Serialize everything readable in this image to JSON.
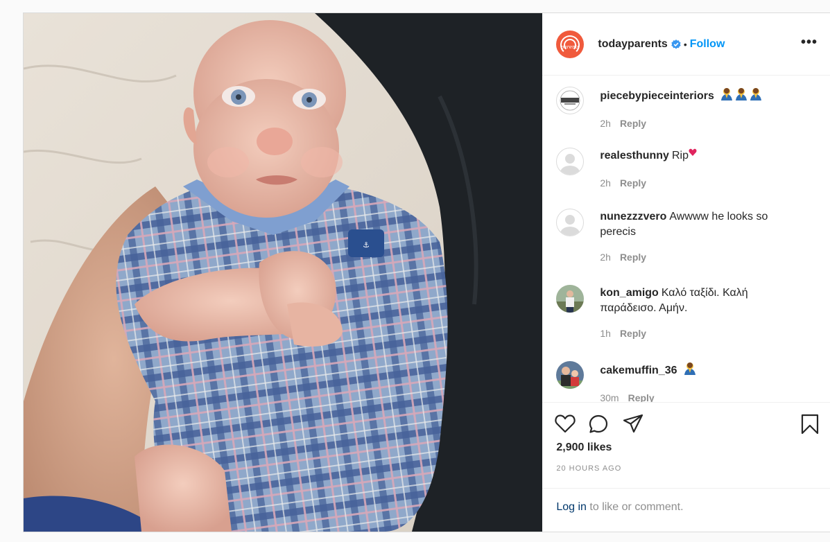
{
  "post": {
    "username": "todayparents",
    "logo_text": "parents",
    "separator": "•",
    "follow_label": "Follow",
    "more_label": "•••",
    "likes": "2,900 likes",
    "time": "20 HOURS AGO",
    "login_link": "Log in",
    "login_rest": " to like or comment."
  },
  "comments": [
    {
      "user": "piecebypieceinteriors",
      "text": "",
      "emoji_count": 3,
      "time": "2h",
      "reply": "Reply"
    },
    {
      "user": "realesthunny",
      "text": "Rip",
      "time": "2h",
      "reply": "Reply"
    },
    {
      "user": "nunezzzvero",
      "text": "Awwww he looks so perecis",
      "time": "2h",
      "reply": "Reply"
    },
    {
      "user": "kon_amigo",
      "text": "Καλό ταξίδι. Καλή παράδεισο. Αμήν.",
      "time": "1h",
      "reply": "Reply"
    },
    {
      "user": "cakemuffin_36",
      "text": "",
      "time": "30m",
      "reply": "Reply"
    }
  ],
  "colors": {
    "accent": "#0095f6",
    "brand": "#f05a3c",
    "muted": "#8e8e8e"
  }
}
